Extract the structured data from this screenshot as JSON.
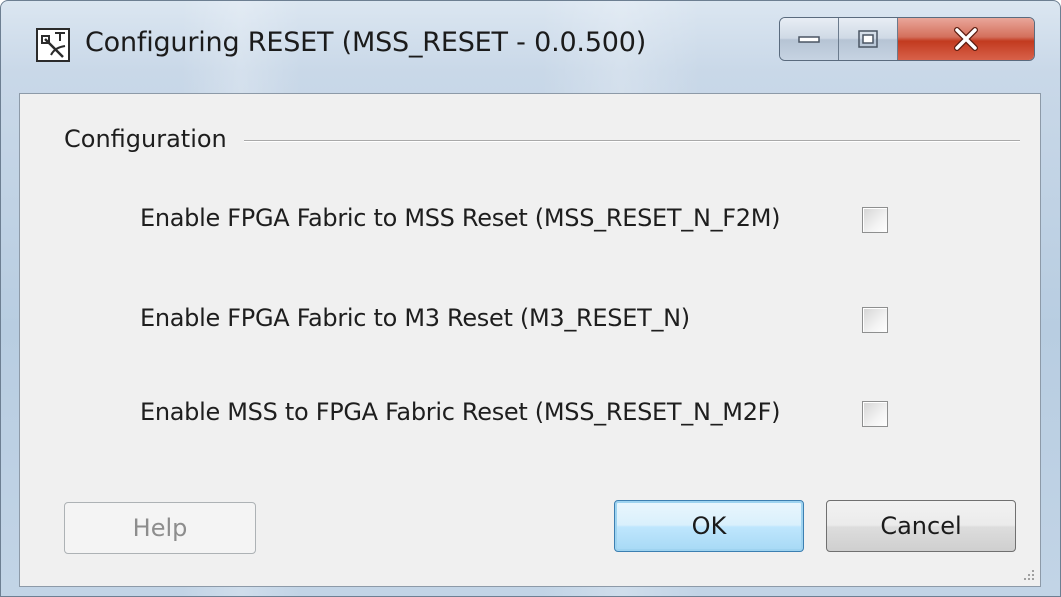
{
  "window": {
    "title": "Configuring RESET (MSS_RESET - 0.0.500)",
    "icon": "reset-config-icon",
    "caption_buttons": [
      "minimize-icon",
      "maximize-icon",
      "close-icon"
    ]
  },
  "group": {
    "label": "Configuration"
  },
  "options": [
    {
      "label": "Enable FPGA Fabric to MSS Reset (MSS_RESET_N_F2M)",
      "checked": false
    },
    {
      "label": "Enable FPGA Fabric to M3 Reset  (M3_RESET_N)",
      "checked": false
    },
    {
      "label": "Enable MSS to FPGA Fabric Reset (MSS_RESET_N_M2F)",
      "checked": false
    }
  ],
  "buttons": {
    "help": "Help",
    "ok": "OK",
    "cancel": "Cancel"
  },
  "colors": {
    "ok_accent": "#3c7fb1",
    "close_red": "#c23a1f",
    "dialog_bg": "#f0f0f0"
  }
}
